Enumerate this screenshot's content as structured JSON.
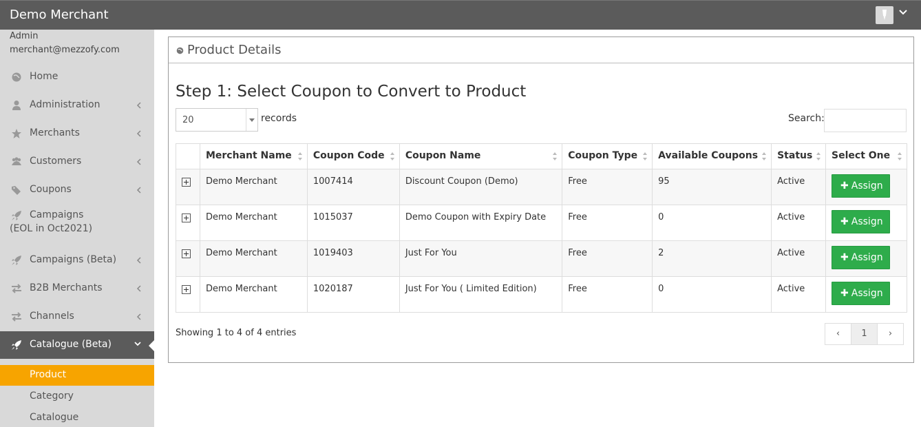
{
  "header": {
    "brand": "Demo Merchant"
  },
  "sidebar": {
    "role": "Admin",
    "email": "merchant@mezzofy.com",
    "items": [
      {
        "label": "Home",
        "icon": "globe-icon"
      },
      {
        "label": "Administration",
        "icon": "user-icon"
      },
      {
        "label": "Merchants",
        "icon": "star-icon"
      },
      {
        "label": "Customers",
        "icon": "users-icon"
      },
      {
        "label": "Coupons",
        "icon": "tag-icon"
      },
      {
        "label": "Campaigns",
        "label2": "(EOL in Oct2021)",
        "icon": "rocket-icon"
      },
      {
        "label": "Campaigns (Beta)",
        "icon": "rocket-icon"
      },
      {
        "label": "B2B Merchants",
        "icon": "exchange-icon"
      },
      {
        "label": "Channels",
        "icon": "exchange-icon"
      },
      {
        "label": "Catalogue (Beta)",
        "icon": "rocket-icon"
      }
    ],
    "subitems": [
      {
        "label": "Product"
      },
      {
        "label": "Category"
      },
      {
        "label": "Catalogue"
      }
    ]
  },
  "panel": {
    "title": "Product Details",
    "step_title": "Step 1: Select Coupon to Convert to Product",
    "page_length": "20",
    "page_length_label": "records",
    "search_label": "Search:",
    "search_value": "",
    "columns": [
      "Merchant Name",
      "Coupon Code",
      "Coupon Name",
      "Coupon Type",
      "Available Coupons",
      "Status",
      "Select One"
    ],
    "rows": [
      {
        "merchant": "Demo Merchant",
        "code": "1007414",
        "name": "Discount Coupon (Demo)",
        "type": "Free",
        "available": "95",
        "status": "Active",
        "action": "Assign"
      },
      {
        "merchant": "Demo Merchant",
        "code": "1015037",
        "name": "Demo Coupon with Expiry Date",
        "type": "Free",
        "available": "0",
        "status": "Active",
        "action": "Assign"
      },
      {
        "merchant": "Demo Merchant",
        "code": "1019403",
        "name": "Just For You",
        "type": "Free",
        "available": "2",
        "status": "Active",
        "action": "Assign"
      },
      {
        "merchant": "Demo Merchant",
        "code": "1020187",
        "name": "Just For You ( Limited Edition)",
        "type": "Free",
        "available": "0",
        "status": "Active",
        "action": "Assign"
      }
    ],
    "info": "Showing 1 to 4 of 4 entries",
    "pager": {
      "prev": "‹",
      "current": "1",
      "next": "›"
    }
  },
  "colors": {
    "topbar": "#5b5b5b",
    "sidebar": "#d9d9d9",
    "selected": "#f7a400",
    "assign": "#2eac4b"
  }
}
